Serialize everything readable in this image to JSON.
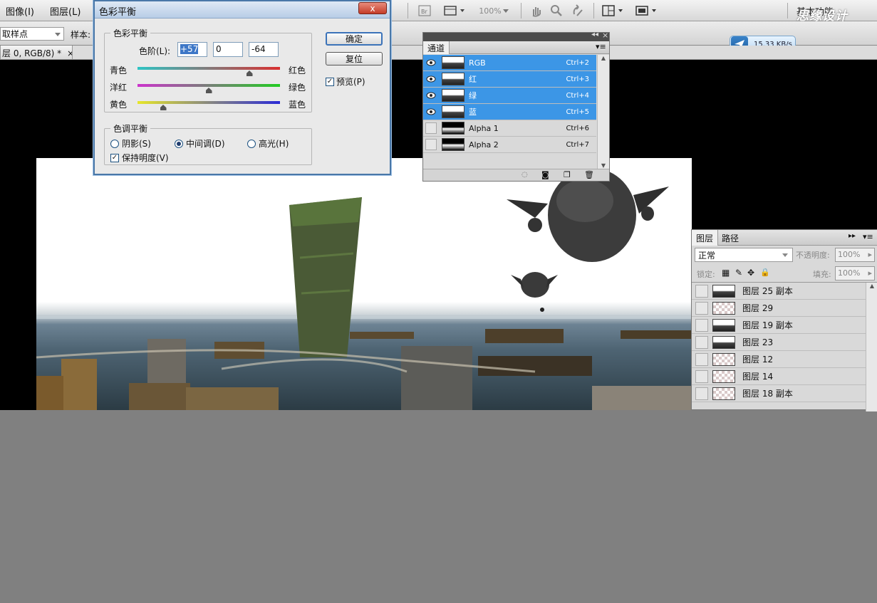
{
  "menu": {
    "items": [
      "图像(I)",
      "图层(L)"
    ]
  },
  "toolbar": {
    "zoom_value": "100%",
    "workspace_label": "基本功能",
    "sample_label": "样本:",
    "point_select": "取样点"
  },
  "watermark": "思缘设计",
  "speed_badge": {
    "text": "15.33 KB/s"
  },
  "document_tab": {
    "title": "层 0, RGB/8) *"
  },
  "color_balance": {
    "title": "色彩平衡",
    "close_icon": "x",
    "section_balance": "色彩平衡",
    "levels_label": "色阶(L):",
    "levels": [
      "+57",
      "0",
      "-64"
    ],
    "sliders": [
      {
        "left": "青色",
        "right": "红色",
        "value": 57,
        "gradient_from": "#2ec4c4",
        "gradient_to": "#d93030"
      },
      {
        "left": "洋红",
        "right": "绿色",
        "value": 0,
        "gradient_from": "#cc33cc",
        "gradient_to": "#22cc22"
      },
      {
        "left": "黄色",
        "right": "蓝色",
        "value": -64,
        "gradient_from": "#e6e62a",
        "gradient_to": "#2a2ad6"
      }
    ],
    "section_tone": "色调平衡",
    "tone_options": [
      "阴影(S)",
      "中间调(D)",
      "高光(H)"
    ],
    "tone_selected": "中间调(D)",
    "preserve_luminosity": "保持明度(V)",
    "preserve_checked": true,
    "ok_button": "确定",
    "reset_button": "复位",
    "preview_label": "预览(P)",
    "preview_checked": true
  },
  "channels_panel": {
    "tab": "通道",
    "rows": [
      {
        "name": "RGB",
        "shortcut": "Ctrl+2",
        "selected": true,
        "visible": true
      },
      {
        "name": "红",
        "shortcut": "Ctrl+3",
        "selected": true,
        "visible": true
      },
      {
        "name": "绿",
        "shortcut": "Ctrl+4",
        "selected": true,
        "visible": true
      },
      {
        "name": "蓝",
        "shortcut": "Ctrl+5",
        "selected": true,
        "visible": true
      },
      {
        "name": "Alpha 1",
        "shortcut": "Ctrl+6",
        "selected": false,
        "visible": false
      },
      {
        "name": "Alpha 2",
        "shortcut": "Ctrl+7",
        "selected": false,
        "visible": false
      }
    ]
  },
  "layers_panel": {
    "tabs": [
      "图层",
      "路径"
    ],
    "blend_mode": "正常",
    "opacity_label": "不透明度:",
    "opacity_value": "100%",
    "lock_label": "锁定:",
    "fill_label": "填充:",
    "fill_value": "100%",
    "rows": [
      {
        "name": "图层 25 副本",
        "thumb": "image"
      },
      {
        "name": "图层 29",
        "thumb": "transparent"
      },
      {
        "name": "图层 19 副本",
        "thumb": "image"
      },
      {
        "name": "图层 23",
        "thumb": "image"
      },
      {
        "name": "图层 12",
        "thumb": "transparent"
      },
      {
        "name": "图层 14",
        "thumb": "transparent"
      },
      {
        "name": "图层 18 副本",
        "thumb": "transparent"
      }
    ]
  }
}
